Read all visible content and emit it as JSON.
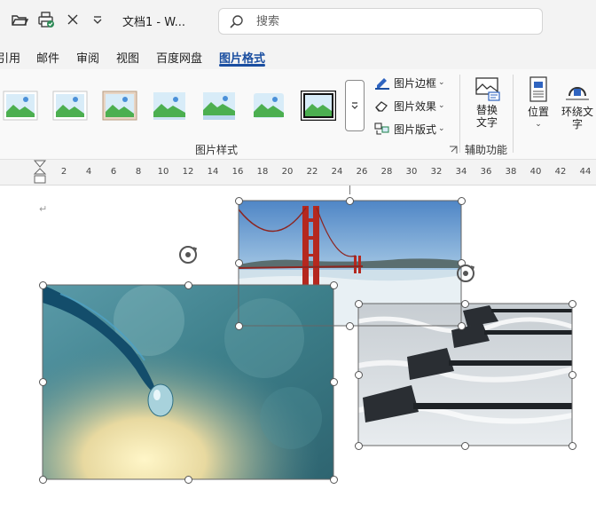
{
  "title_bar": {
    "doc_title": "文档1 - W...",
    "search_placeholder": "搜索",
    "icons": [
      "open-folder-icon",
      "print-preview-icon",
      "close-icon",
      "customize-qat-icon"
    ]
  },
  "tabs": [
    {
      "label": "引用",
      "active": false
    },
    {
      "label": "邮件",
      "active": false
    },
    {
      "label": "审阅",
      "active": false
    },
    {
      "label": "视图",
      "active": false
    },
    {
      "label": "百度网盘",
      "active": false
    },
    {
      "label": "图片格式",
      "active": true
    }
  ],
  "ribbon": {
    "picture_styles_label": "图片样式",
    "commands": {
      "border": "图片边框",
      "effects": "图片效果",
      "layout": "图片版式"
    },
    "alt_text_line1": "替换",
    "alt_text_line2": "文字",
    "accessibility_label": "辅助功能",
    "position": "位置",
    "wrap_text_line1": "环绕文",
    "wrap_text_line2": "字"
  },
  "ruler": {
    "ticks": [
      "2",
      "4",
      "6",
      "8",
      "10",
      "12",
      "14",
      "16",
      "18",
      "20",
      "22",
      "24",
      "26",
      "28",
      "30",
      "32",
      "34",
      "36",
      "38",
      "40",
      "42",
      "44"
    ]
  },
  "document": {
    "paragraph_mark": "↵",
    "pictures": [
      "golden-gate-bridge",
      "water-drop-feather",
      "rowing-oars"
    ]
  },
  "colors": {
    "accent": "#1a4ea0",
    "titlebar_bg": "#f3f3f3",
    "ribbon_bg": "#f9f9f9"
  }
}
